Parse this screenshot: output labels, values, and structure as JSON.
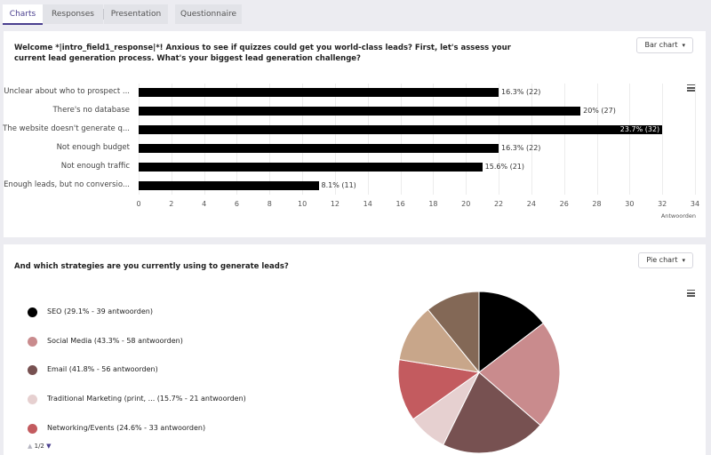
{
  "tabs": [
    {
      "label": "Charts",
      "active": true
    },
    {
      "label": "Responses",
      "active": false
    },
    {
      "label": "Presentation",
      "active": false
    },
    {
      "label": "Questionnaire",
      "active": false
    }
  ],
  "bar_section": {
    "question": "Welcome *|intro_field1_response|*! Anxious to see if quizzes could get you world-class leads? First, let's assess your current lead generation process. What's your biggest lead generation challenge?",
    "chart_type_button": "Bar chart"
  },
  "pie_section": {
    "question": "And which strategies are you currently using to generate leads?",
    "chart_type_button": "Pie chart",
    "legend": [
      {
        "label": "SEO (29.1% - 39 antwoorden)",
        "color": "#000000"
      },
      {
        "label": "Social Media (43.3% - 58 antwoorden)",
        "color": "#c98b8d"
      },
      {
        "label": "Email (41.8% - 56 antwoorden)",
        "color": "#775151"
      },
      {
        "label": "Traditional Marketing (print, ... (15.7% - 21 antwoorden)",
        "color": "#e6d0d0"
      },
      {
        "label": "Networking/Events (24.6% - 33 antwoorden)",
        "color": "#c35b5f"
      }
    ],
    "pager": "1/2"
  },
  "chart_data": [
    {
      "type": "bar",
      "orientation": "horizontal",
      "categories": [
        "Unclear about who to prospect ...",
        "There's no database",
        "The website doesn't generate q...",
        "Not enough budget",
        "Not enough traffic",
        "Enough leads, but no conversio..."
      ],
      "values": [
        22,
        27,
        32,
        22,
        21,
        11
      ],
      "data_labels": [
        "16.3% (22)",
        "20% (27)",
        "23.7% (32)",
        "16.3% (22)",
        "15.6% (21)",
        "8.1% (11)"
      ],
      "xlim": [
        0,
        34
      ],
      "xticks": [
        "0",
        "2",
        "4",
        "6",
        "8",
        "10",
        "12",
        "14",
        "16",
        "18",
        "20",
        "22",
        "24",
        "26",
        "28",
        "30",
        "32",
        "34"
      ],
      "xlabel": "Antwoorden",
      "bar_color": "#000000",
      "grid": true
    },
    {
      "type": "pie",
      "slices": [
        {
          "value": 39,
          "color": "#000000"
        },
        {
          "value": 58,
          "color": "#c98b8d"
        },
        {
          "value": 56,
          "color": "#775151"
        },
        {
          "value": 21,
          "color": "#e6d0d0"
        },
        {
          "value": 33,
          "color": "#c35b5f"
        },
        {
          "value": 31,
          "color": "#c8a68a"
        },
        {
          "value": 29,
          "color": "#836856"
        }
      ],
      "legend_placement": "left"
    }
  ]
}
